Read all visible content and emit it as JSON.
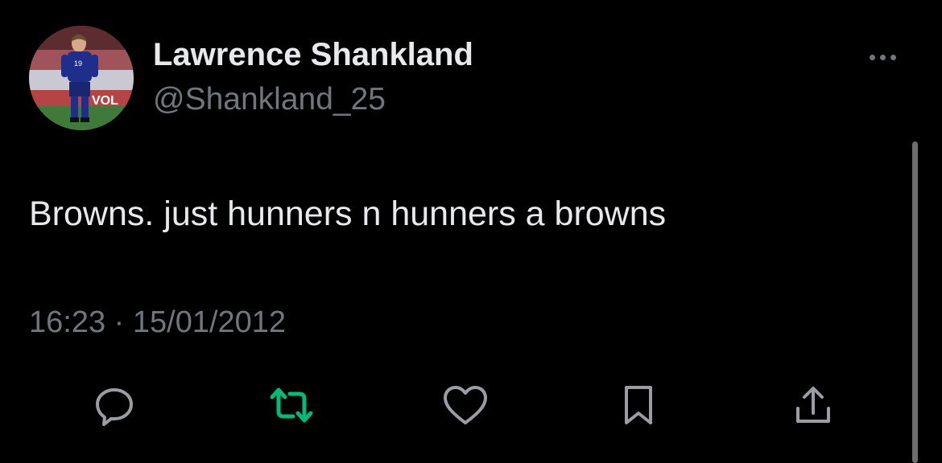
{
  "tweet": {
    "display_name": "Lawrence Shankland",
    "handle": "@Shankland_25",
    "text": "Browns. just hunners n hunners a browns",
    "time": "16:23",
    "separator": "·",
    "date": "15/01/2012"
  },
  "avatar": {
    "jersey_number": "19",
    "banner_text": "VOL"
  },
  "actions": {
    "reply_icon": "reply-bubble-icon",
    "retweet_icon": "retweet-icon",
    "like_icon": "heart-icon",
    "bookmark_icon": "bookmark-icon",
    "share_icon": "share-icon"
  },
  "colors": {
    "background": "#000000",
    "primary_text": "#e7e9ea",
    "secondary_text": "#71767b",
    "retweet_active": "#00ba7c",
    "icon": "#9a9ea2"
  }
}
